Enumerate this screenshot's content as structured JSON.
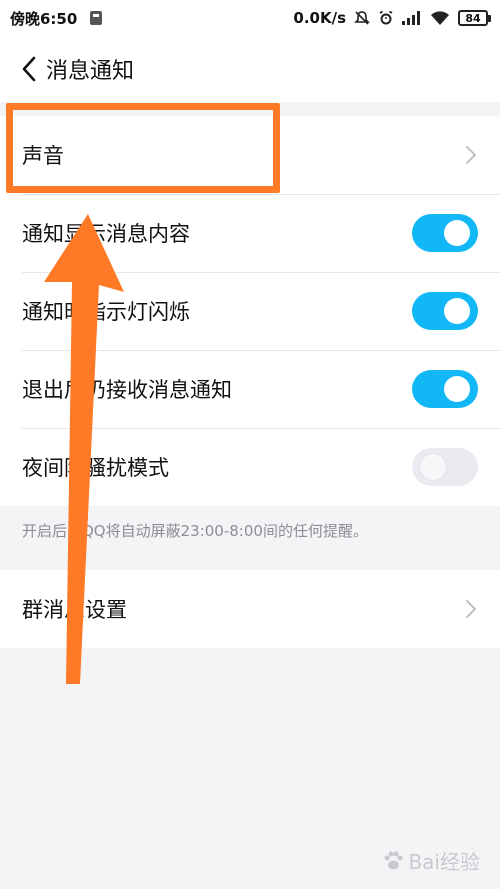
{
  "status_bar": {
    "time": "傍晚6:50",
    "network_speed": "0.0K/s",
    "battery": "84"
  },
  "nav": {
    "back_icon": "chevron-left-icon",
    "title": "消息通知"
  },
  "settings": {
    "sound": {
      "label": "声音"
    },
    "show_content": {
      "label": "通知显示消息内容",
      "enabled": true
    },
    "indicator_light": {
      "label": "通知时指示灯闪烁",
      "enabled": true
    },
    "receive_after_exit": {
      "label": "退出后仍接收消息通知",
      "enabled": true
    },
    "night_mode": {
      "label": "夜间防骚扰模式",
      "enabled": false
    }
  },
  "night_mode_hint": "开启后，QQ将自动屏蔽23:00-8:00间的任何提醒。",
  "group_settings": {
    "label": "群消息设置"
  },
  "annotation": {
    "highlight_color": "#ff7a26",
    "toggle_on_color": "#12b7f5"
  },
  "watermark": {
    "text": "Bai经验",
    "icon": "paw-icon"
  }
}
